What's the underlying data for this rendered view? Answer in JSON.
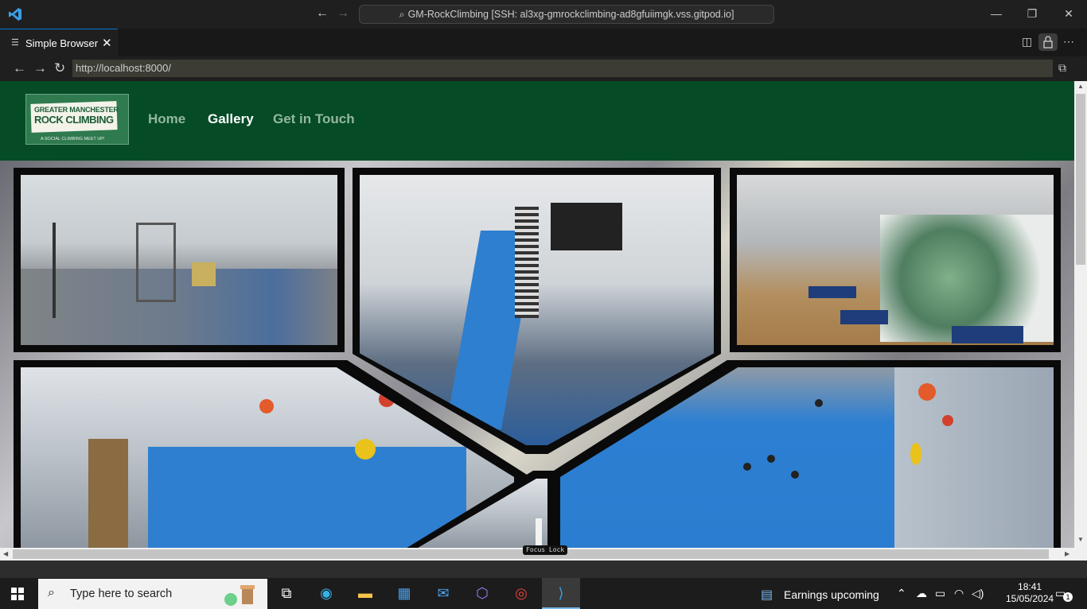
{
  "window": {
    "command_center": "GM-RockClimbing [SSH: al3xg-gmrockclimbing-ad8gfuiimgk.vss.gitpod.io]",
    "minimize": "—",
    "restore": "❐",
    "close": "✕"
  },
  "tab": {
    "label": "Simple Browser",
    "close": "✕"
  },
  "browser": {
    "url": "http://localhost:8000/",
    "back": "←",
    "forward": "→",
    "reload": "↻",
    "open_external": "⧉"
  },
  "site": {
    "logo": {
      "line1": "GREATER MANCHESTER",
      "line2": "ROCK CLIMBING",
      "tagline": "A SOCIAL CLIMBING MEET UP!"
    },
    "nav": [
      {
        "label": "Home",
        "active": false
      },
      {
        "label": "Gallery",
        "active": true
      },
      {
        "label": "Get in Touch",
        "active": false
      }
    ],
    "brand_color": "#054b25",
    "gallery_photos": [
      "gym",
      "stairs",
      "dragon-mural",
      "wall-slope",
      "bottom-center",
      "bouldering-floor"
    ]
  },
  "overlay": {
    "focus_lock": "Focus Lock"
  },
  "taskbar": {
    "search_placeholder": "Type here to search",
    "news": "Earnings upcoming",
    "time": "18:41",
    "date": "15/05/2024",
    "notifications": "1",
    "apps": [
      "task-view",
      "edge",
      "file-explorer",
      "store",
      "mail",
      "copilot",
      "chrome",
      "vscode"
    ]
  }
}
